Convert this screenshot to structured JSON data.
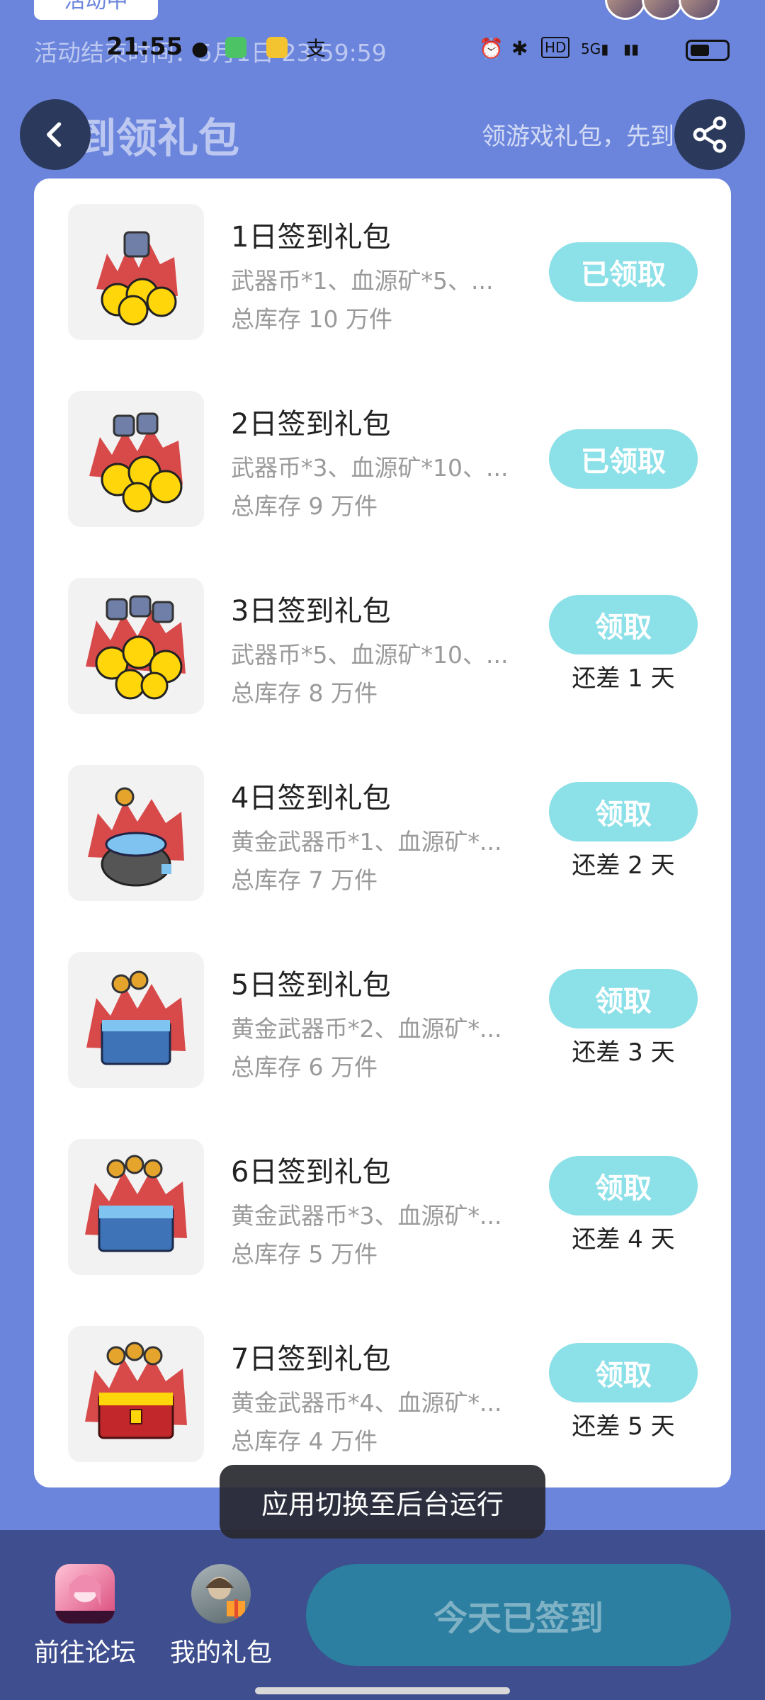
{
  "top": {
    "tag": "活动中",
    "end_text": "活动结束时间：5月1日 23:59:59",
    "page_title": "签到领礼包",
    "page_subtitle": "领游戏礼包，先到先得"
  },
  "status_bar": {
    "time": "21:55",
    "network": "5G"
  },
  "gifts": [
    {
      "title": "1日签到礼包",
      "desc": "武器币*1、血源矿*5、...",
      "stock": "总库存 10 万件",
      "button": "已领取",
      "remain": ""
    },
    {
      "title": "2日签到礼包",
      "desc": "武器币*3、血源矿*10、...",
      "stock": "总库存 9 万件",
      "button": "已领取",
      "remain": ""
    },
    {
      "title": "3日签到礼包",
      "desc": "武器币*5、血源矿*10、...",
      "stock": "总库存 8 万件",
      "button": "领取",
      "remain": "还差 1 天"
    },
    {
      "title": "4日签到礼包",
      "desc": "黄金武器币*1、血源矿*...",
      "stock": "总库存 7 万件",
      "button": "领取",
      "remain": "还差 2 天"
    },
    {
      "title": "5日签到礼包",
      "desc": "黄金武器币*2、血源矿*...",
      "stock": "总库存 6 万件",
      "button": "领取",
      "remain": "还差 3 天"
    },
    {
      "title": "6日签到礼包",
      "desc": "黄金武器币*3、血源矿*...",
      "stock": "总库存 5 万件",
      "button": "领取",
      "remain": "还差 4 天"
    },
    {
      "title": "7日签到礼包",
      "desc": "黄金武器币*4、血源矿*...",
      "stock": "总库存 4 万件",
      "button": "领取",
      "remain": "还差 5 天"
    }
  ],
  "toast": "应用切换至后台运行",
  "bottom": {
    "forum_label": "前往论坛",
    "gifts_label": "我的礼包",
    "signed_label": "今天已签到"
  },
  "colors": {
    "background": "#6b85dd",
    "accent": "#8ce0e8",
    "bottom_bar": "#3e4e8e",
    "signed_button": "#2c7fa0"
  }
}
